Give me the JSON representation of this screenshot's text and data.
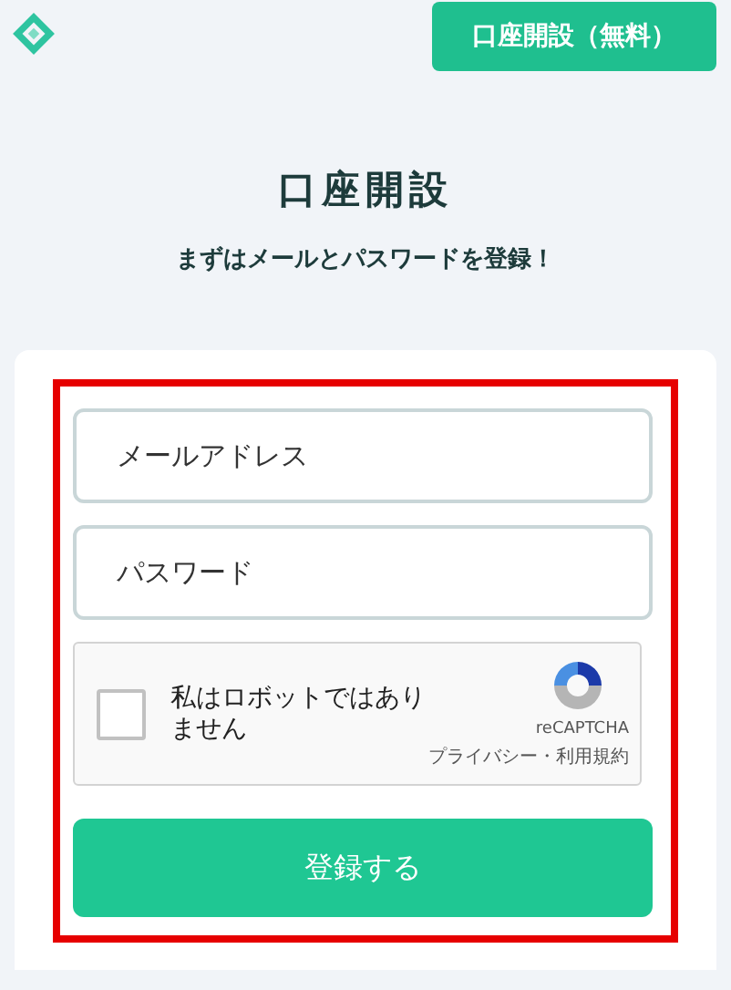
{
  "header": {
    "signup_button": "口座開設（無料）"
  },
  "heading": "口座開設",
  "subheading": "まずはメールとパスワードを登録！",
  "form": {
    "fields": [
      {
        "placeholder": "メールアドレス"
      },
      {
        "placeholder": "パスワード"
      }
    ],
    "captcha": {
      "label": "私はロボットではありません",
      "checked": false,
      "brand": "reCAPTCHA",
      "links": "プライバシー・利用規約"
    },
    "submit": "登録する"
  }
}
